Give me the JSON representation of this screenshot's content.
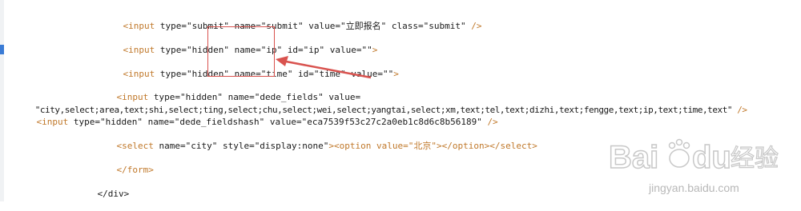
{
  "editor": {
    "lines": [
      {
        "tag": "<input",
        "rest": " type=\"submit\" name=\"submit\" value=\"立即报名\" class=\"submit\" ",
        "close": "/>"
      },
      {
        "tag": "<input",
        "rest": " type=\"hidden\" name=\"ip\" id=\"ip\" value=\"\"",
        "close": ">"
      },
      {
        "tag": "<input",
        "rest": " type=\"hidden\" name=\"time\" id=\"time\" value=\"\"",
        "close": ">"
      },
      {
        "tag": "<input",
        "rest": " type=\"hidden\" name=\"dede_fields\" value=",
        "close": ""
      },
      {
        "tag": "",
        "rest": "\"city,select;area,text;shi,select;ting,select;chu,select;wei,select;yangtai,select;xm,text;tel,text;dizhi,text;fengge,text;ip,text;time,text\" ",
        "close": "/>"
      },
      {
        "tag": "<input",
        "rest": " type=\"hidden\" name=\"dede_fieldshash\" value=\"eca7539f53c27c2a0eb1c8d6c8b56189\" ",
        "close": "/>"
      },
      {
        "tag": "<select",
        "rest": " name=\"city\" style=\"display:none\"",
        "close": "><option value=\"北京\"></option></select>"
      },
      {
        "tag": "</form>",
        "rest": "",
        "close": ""
      },
      {
        "tag": "</div>",
        "rest": "",
        "close": ""
      }
    ]
  },
  "watermark": {
    "logo_text": "Bai",
    "logo_text2": "du",
    "cn_text": "经验",
    "url": "jingyan.baidu.com"
  },
  "colors": {
    "tag": "#c0782a",
    "highlight": "#d9534f"
  }
}
